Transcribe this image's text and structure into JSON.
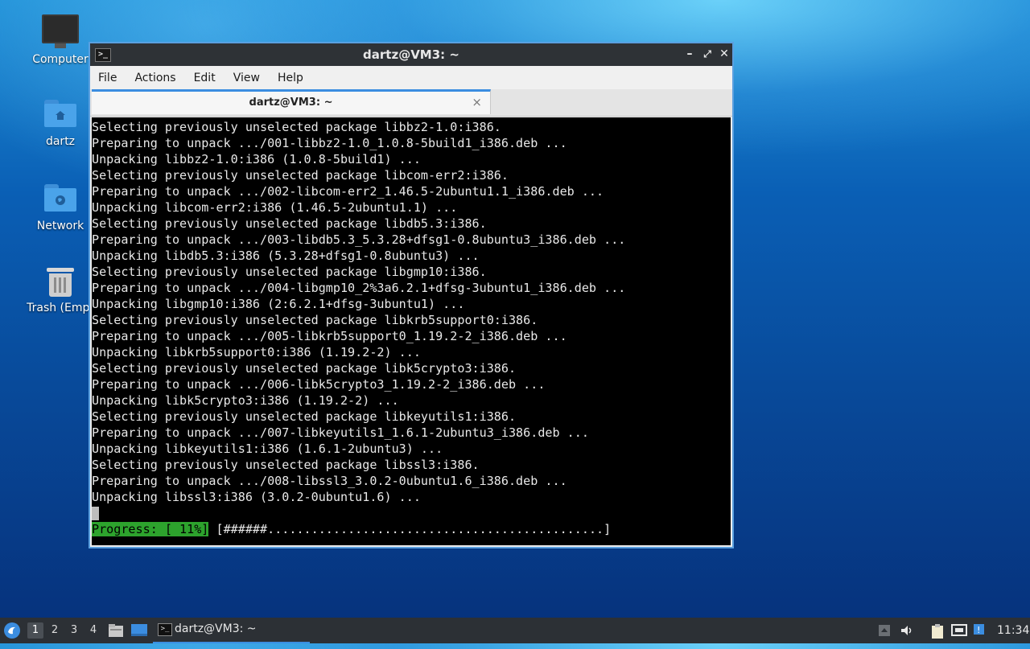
{
  "desktop": {
    "icons": [
      {
        "label": "Computer"
      },
      {
        "label": "dartz"
      },
      {
        "label": "Network"
      },
      {
        "label": "Trash (Empt"
      }
    ]
  },
  "window": {
    "title": "dartz@VM3: ~",
    "menu": [
      "File",
      "Actions",
      "Edit",
      "View",
      "Help"
    ],
    "tab_title": "dartz@VM3: ~",
    "tab_close": "×",
    "terminal_lines": [
      "Selecting previously unselected package libbz2-1.0:i386.",
      "Preparing to unpack .../001-libbz2-1.0_1.0.8-5build1_i386.deb ...",
      "Unpacking libbz2-1.0:i386 (1.0.8-5build1) ...",
      "Selecting previously unselected package libcom-err2:i386.",
      "Preparing to unpack .../002-libcom-err2_1.46.5-2ubuntu1.1_i386.deb ...",
      "Unpacking libcom-err2:i386 (1.46.5-2ubuntu1.1) ...",
      "Selecting previously unselected package libdb5.3:i386.",
      "Preparing to unpack .../003-libdb5.3_5.3.28+dfsg1-0.8ubuntu3_i386.deb ...",
      "Unpacking libdb5.3:i386 (5.3.28+dfsg1-0.8ubuntu3) ...",
      "Selecting previously unselected package libgmp10:i386.",
      "Preparing to unpack .../004-libgmp10_2%3a6.2.1+dfsg-3ubuntu1_i386.deb ...",
      "Unpacking libgmp10:i386 (2:6.2.1+dfsg-3ubuntu1) ...",
      "Selecting previously unselected package libkrb5support0:i386.",
      "Preparing to unpack .../005-libkrb5support0_1.19.2-2_i386.deb ...",
      "Unpacking libkrb5support0:i386 (1.19.2-2) ...",
      "Selecting previously unselected package libk5crypto3:i386.",
      "Preparing to unpack .../006-libk5crypto3_1.19.2-2_i386.deb ...",
      "Unpacking libk5crypto3:i386 (1.19.2-2) ...",
      "Selecting previously unselected package libkeyutils1:i386.",
      "Preparing to unpack .../007-libkeyutils1_1.6.1-2ubuntu3_i386.deb ...",
      "Unpacking libkeyutils1:i386 (1.6.1-2ubuntu3) ...",
      "Selecting previously unselected package libssl3:i386.",
      "Preparing to unpack .../008-libssl3_3.0.2-0ubuntu1.6_i386.deb ...",
      "Unpacking libssl3:i386 (3.0.2-0ubuntu1.6) ..."
    ],
    "progress_label": "Progress: [ 11%]",
    "progress_bar": " [######..............................................]"
  },
  "taskbar": {
    "workspaces": [
      "1",
      "2",
      "3",
      "4"
    ],
    "active_workspace": "1",
    "task_label": "dartz@VM3: ~",
    "clock": "11:34"
  }
}
